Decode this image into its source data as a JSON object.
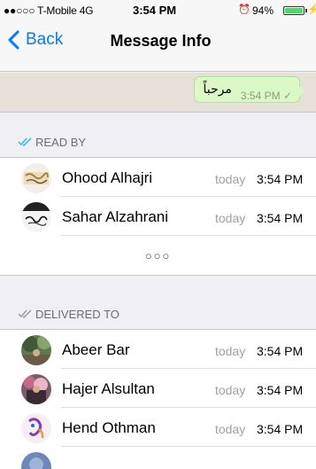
{
  "status_bar": {
    "carrier": "●●○○○ T-Mobile  4G",
    "time": "3:54 PM",
    "battery": "94%"
  },
  "nav": {
    "back_label": "Back",
    "title": "Message Info"
  },
  "message": {
    "text": "مرحباً",
    "time": "3:54 PM",
    "status_icon": "single-check-icon"
  },
  "read_by": {
    "header": "READ BY",
    "rows": [
      {
        "name": "Ohood Alhajri",
        "day": "today",
        "time": "3:54 PM"
      },
      {
        "name": "Sahar Alzahrani",
        "day": "today",
        "time": "3:54 PM"
      }
    ],
    "more_label": "○○○"
  },
  "delivered_to": {
    "header": "DELIVERED TO",
    "rows": [
      {
        "name": "Abeer Bar",
        "day": "today",
        "time": "3:54 PM"
      },
      {
        "name": "Hajer Alsultan",
        "day": "today",
        "time": "3:54 PM"
      },
      {
        "name": "Hend Othman",
        "day": "today",
        "time": "3:54 PM"
      }
    ]
  },
  "colors": {
    "accent": "#007aff",
    "bubble": "#dcf8c6",
    "read_check": "#34b7f1",
    "battery": "#4cd964"
  }
}
